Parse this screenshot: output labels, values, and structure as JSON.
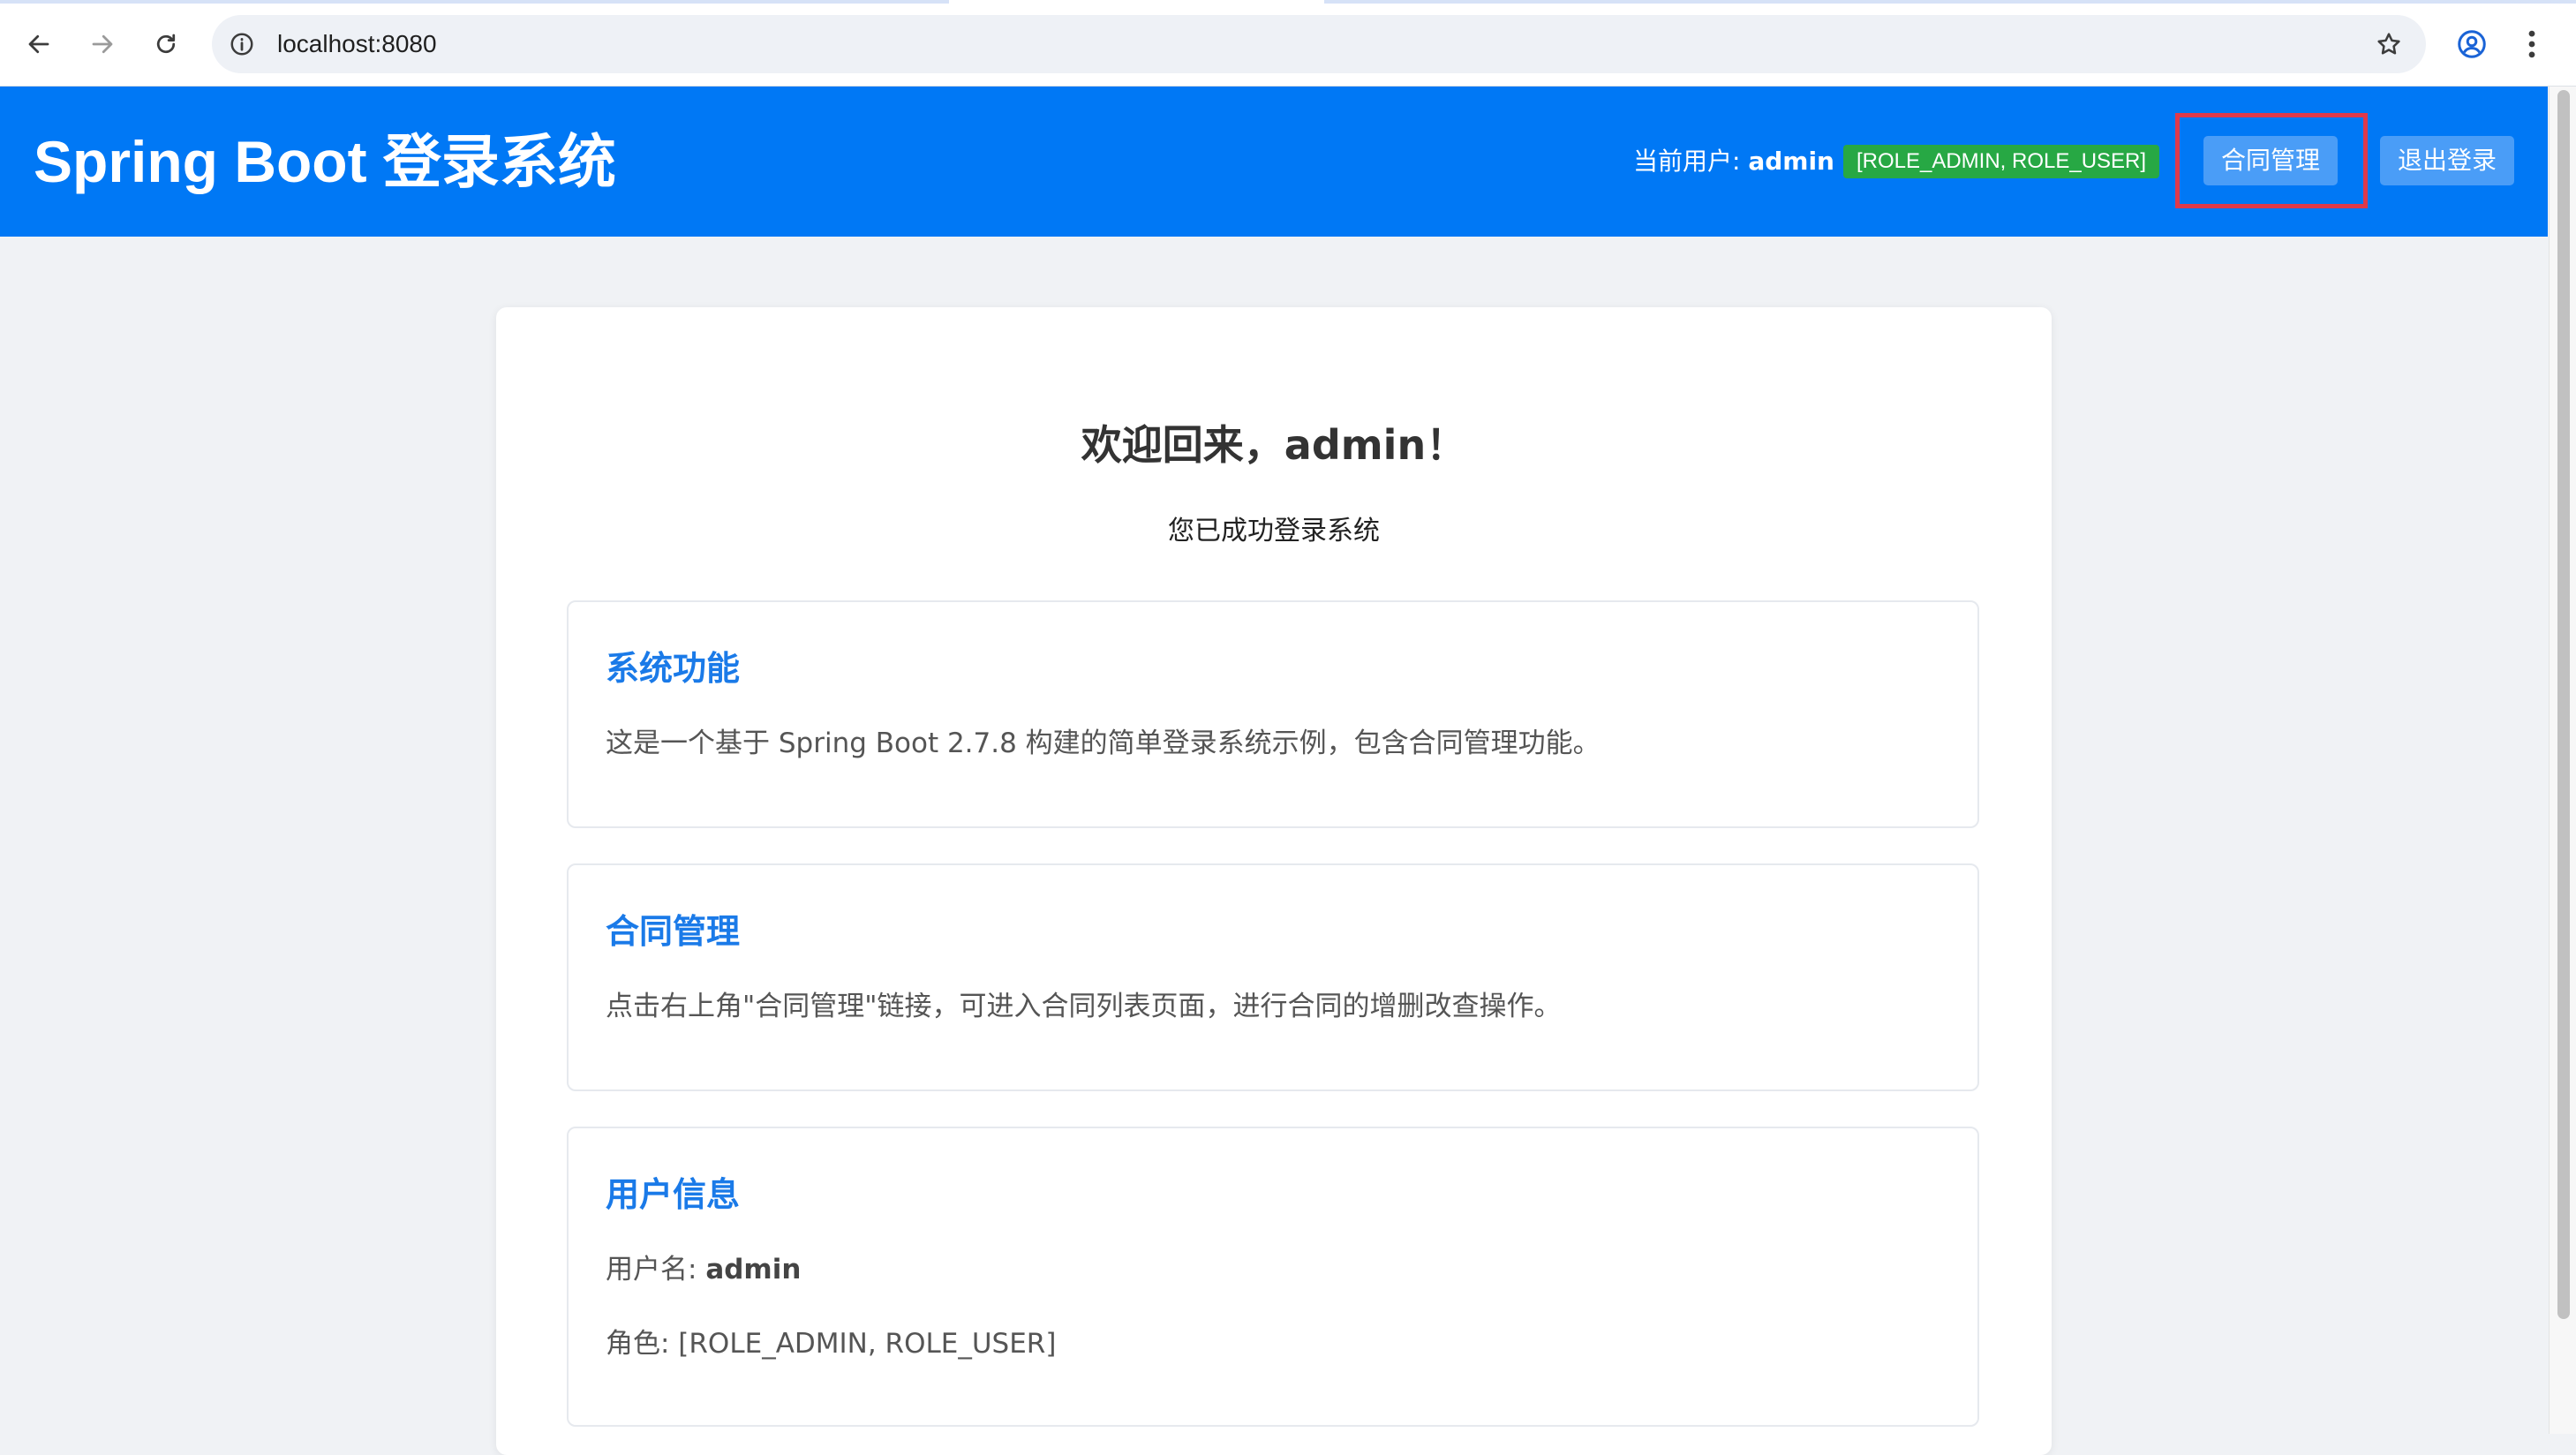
{
  "browser": {
    "url": "localhost:8080",
    "icons": [
      "back-arrow-icon",
      "forward-arrow-icon",
      "reload-icon",
      "info-icon",
      "star-icon",
      "profile-icon",
      "kebab-menu-icon"
    ]
  },
  "header": {
    "title": "Spring Boot 登录系统",
    "current_user_label": "当前用户: ",
    "current_user": "admin",
    "roles_badge": "[ROLE_ADMIN, ROLE_USER]",
    "contract_button": "合同管理",
    "logout_button": "退出登录"
  },
  "main": {
    "welcome": "欢迎回来，admin！",
    "subtext": "您已成功登录系统",
    "sections": [
      {
        "title": "系统功能",
        "text": "这是一个基于 Spring Boot 2.7.8 构建的简单登录系统示例，包含合同管理功能。"
      },
      {
        "title": "合同管理",
        "text": "点击右上角\"合同管理\"链接，可进入合同列表页面，进行合同的增删改查操作。"
      },
      {
        "title": "用户信息",
        "username_label": "用户名: ",
        "username": "admin",
        "roles_text": "角色: [ROLE_ADMIN, ROLE_USER]"
      }
    ]
  },
  "colors": {
    "header_bg": "#0078f5",
    "badge_green": "#27a844",
    "section_title": "#1a7ae8",
    "highlight_box": "#e0394a"
  }
}
